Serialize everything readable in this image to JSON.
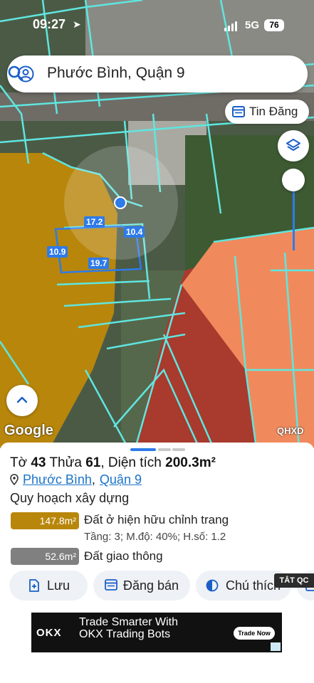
{
  "status_bar": {
    "time": "09:27",
    "network": "5G",
    "battery": "76"
  },
  "search": {
    "value": "Phước Bình, Quận 9"
  },
  "map": {
    "post_button_label": "Tin Đăng",
    "attribution": "Google",
    "layer_code": "QHXD",
    "dimensions": {
      "top": "17.2",
      "right": "10.4",
      "left": "10.9",
      "bottom": "19.7"
    }
  },
  "parcel": {
    "sheet_label": "Tờ",
    "sheet_no": "43",
    "plot_label": "Thửa",
    "plot_no": "61",
    "area_label": "Diện tích",
    "area_value": "200.3m²",
    "ward": "Phước Bình",
    "district": "Quận 9",
    "planning_heading": "Quy hoạch xây dựng",
    "zones": [
      {
        "area": "147.8m²",
        "label": "Đất ở hiện hữu chỉnh trang",
        "detail": "Tầng: 3; M.độ: 40%; H.số: 1.2",
        "color": "#b8860b",
        "fraction": 0.738
      },
      {
        "area": "52.6m²",
        "label": "Đất giao thông",
        "detail": "",
        "color": "#808080",
        "fraction": 0.262
      }
    ]
  },
  "actions": {
    "save": "Lưu",
    "sell": "Đăng bán",
    "legend": "Chú thích"
  },
  "ad": {
    "close_label": "TẮT QC",
    "brand": "OKX",
    "headline_1": "Trade Smarter With",
    "headline_2": "OKX Trading Bots",
    "cta": "Trade Now"
  },
  "colors": {
    "accent": "#2e7be9",
    "zone_residential": "#b8860b",
    "zone_traffic": "#808080",
    "zone_red": "#a83a2e",
    "zone_orange": "#f08a5d"
  }
}
